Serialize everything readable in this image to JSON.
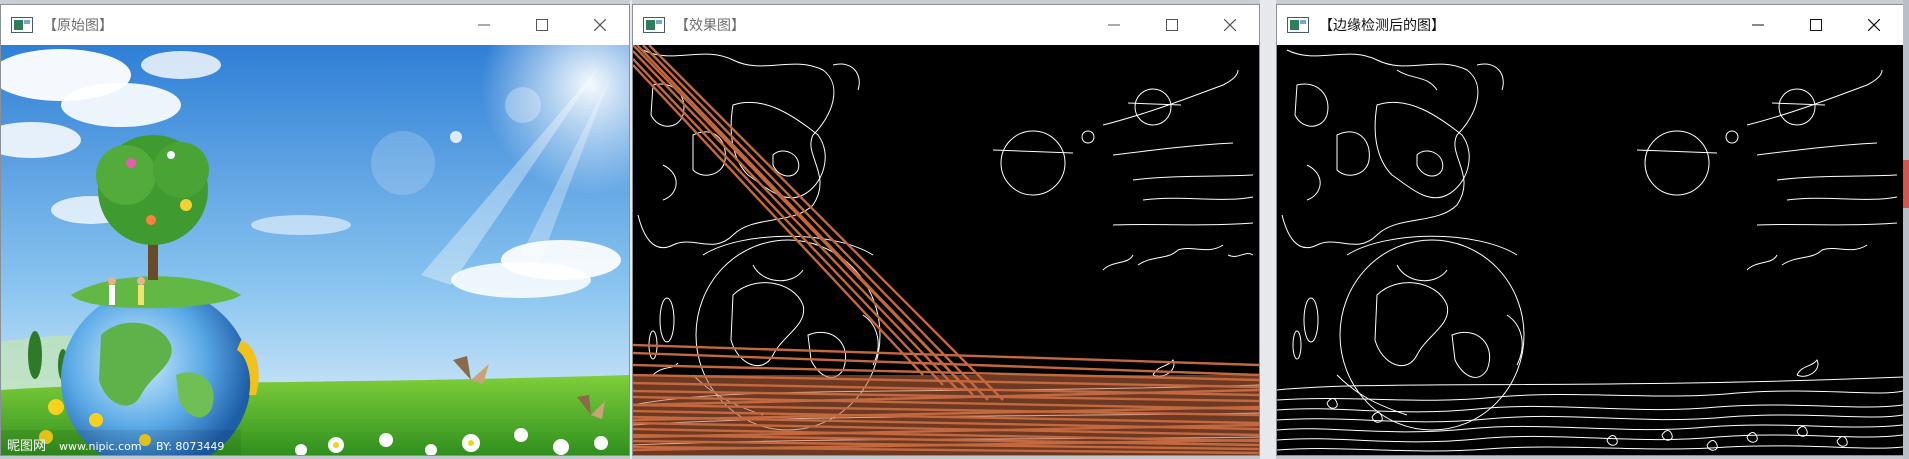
{
  "desktop": {
    "strip_color": "#c9cdd4"
  },
  "windows": [
    {
      "title": "【原始图】",
      "title_color": "#6d6d6d",
      "icon": "image-window-icon",
      "controls": [
        "minimize-icon",
        "maximize-icon",
        "close-icon"
      ],
      "watermark": {
        "site_text": "昵图网",
        "url_text": "www.nipic.com",
        "by_text": "BY: 8073449"
      }
    },
    {
      "title": "【效果图】",
      "title_color": "#6d6d6d",
      "icon": "image-window-icon",
      "controls": [
        "minimize-icon",
        "maximize-icon",
        "close-icon"
      ],
      "line_color": "#c4683f"
    },
    {
      "title": "【边缘检测后的图】",
      "title_color": "#111111",
      "icon": "image-window-icon",
      "controls": [
        "minimize-icon",
        "maximize-icon",
        "close-icon"
      ]
    }
  ]
}
